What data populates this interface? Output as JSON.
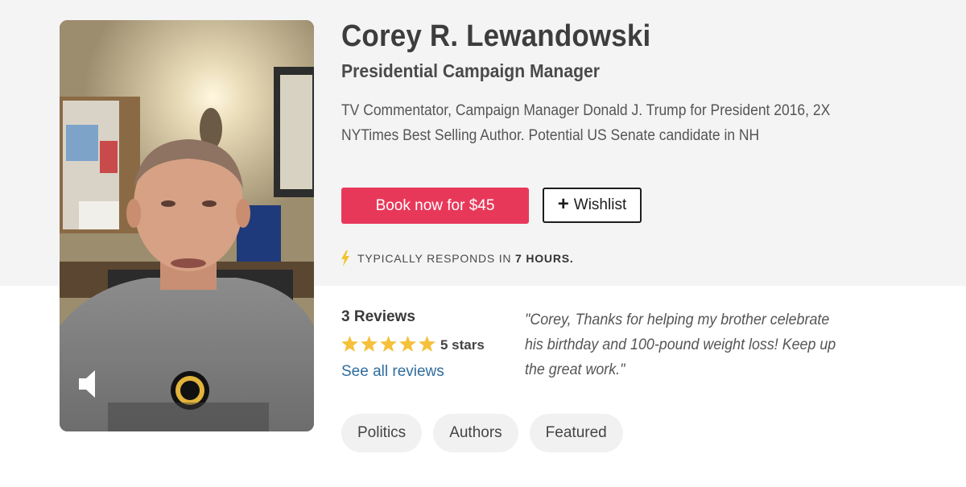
{
  "profile": {
    "name": "Corey R. Lewandowski",
    "title": "Presidential Campaign Manager",
    "bio": "TV Commentator, Campaign Manager Donald J. Trump for President 2016, 2X NYTimes Best Selling Author. Potential US Senate candidate in NH"
  },
  "actions": {
    "book_label": "Book now for $45",
    "wishlist_label": "Wishlist"
  },
  "response": {
    "prefix": "TYPICALLY RESPONDS IN",
    "time": "7 HOURS",
    "suffix": "."
  },
  "reviews": {
    "count_label": "3 Reviews",
    "rating": 5,
    "rating_label": "5 stars",
    "see_all": "See all reviews",
    "quote": "\"Corey, Thanks for helping my brother celebrate his birthday and 100-pound weight loss! Keep up the great work.\""
  },
  "tags": [
    "Politics",
    "Authors",
    "Featured"
  ],
  "colors": {
    "accent": "#e8385a",
    "link": "#2f6d9e",
    "star": "#f5c03b",
    "bolt": "#f2c230"
  },
  "icons": {
    "mute": "speaker-icon",
    "bolt": "lightning-icon",
    "star": "star-icon",
    "plus": "plus-icon"
  }
}
